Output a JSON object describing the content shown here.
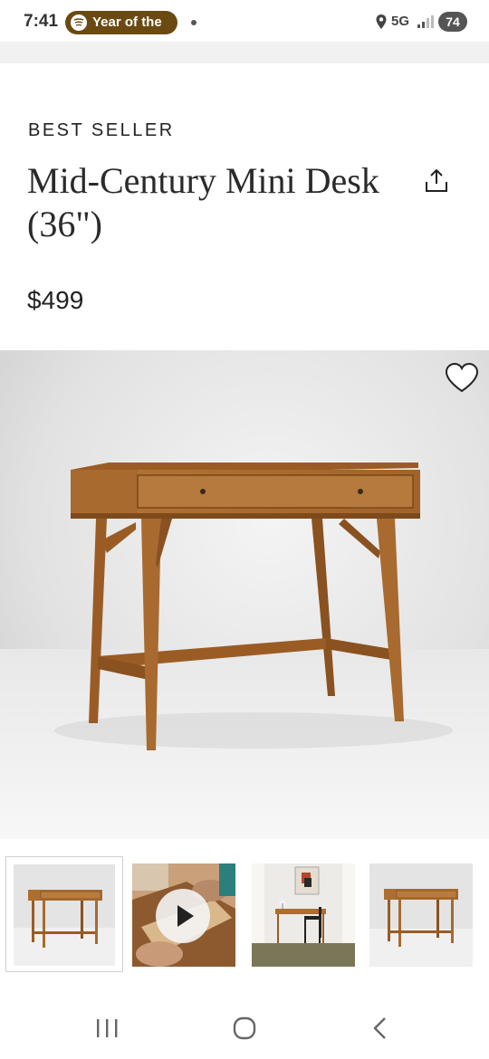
{
  "status_bar": {
    "time": "7:41",
    "media_pill_text": "Year of the",
    "network": "5G",
    "battery": "74"
  },
  "product": {
    "eyebrow": "BEST SELLER",
    "title": "Mid-Century Mini Desk (36\")",
    "price": "$499"
  },
  "icons": {
    "share": "share-icon",
    "favorite": "heart-icon",
    "play": "play-icon",
    "recents": "recents-icon",
    "home": "home-icon",
    "back": "back-icon"
  },
  "colors": {
    "wood": "#a8682c",
    "wood_dark": "#8a5220",
    "media_pill": "#6b4a12",
    "background": "#ffffff",
    "strip": "#f1f1f1"
  },
  "thumbnails": [
    {
      "kind": "desk-photo",
      "selected": true
    },
    {
      "kind": "video",
      "selected": false
    },
    {
      "kind": "room-scene",
      "selected": false
    },
    {
      "kind": "desk-photo",
      "selected": false
    }
  ]
}
